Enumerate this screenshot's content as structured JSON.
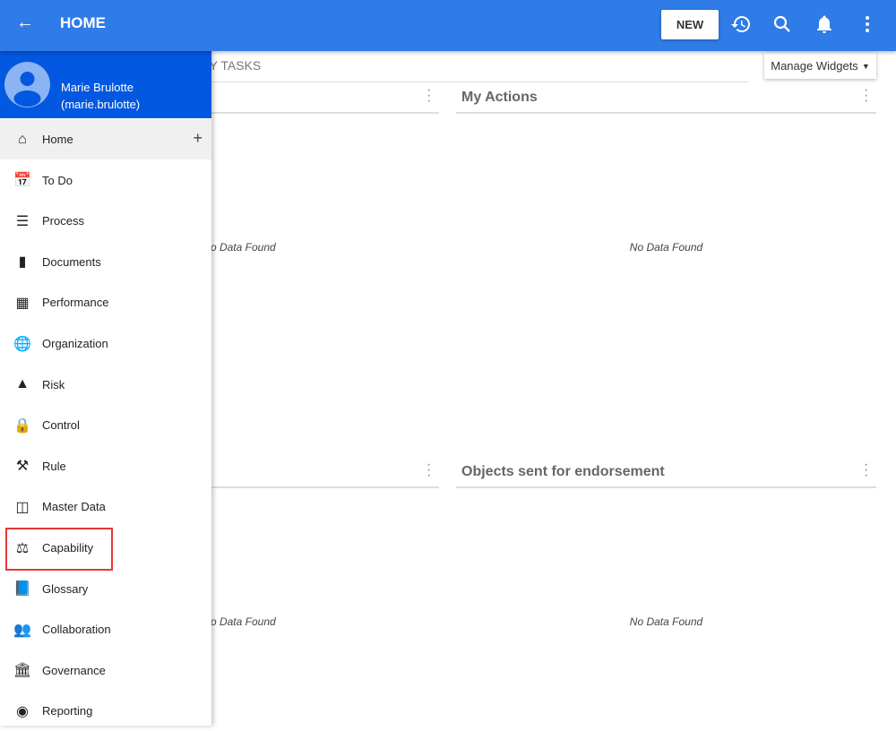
{
  "header": {
    "back_icon": "arrow-left-icon",
    "title": "HOME",
    "new_label": "NEW",
    "icons": [
      "history-icon",
      "search-icon",
      "bell-icon",
      "more-vert-icon"
    ]
  },
  "tabs": {
    "my_tasks": "MY TASKS"
  },
  "manage_widgets": "Manage Widgets",
  "widgets": [
    {
      "title": "",
      "empty": "No Data Found"
    },
    {
      "title": "My Actions",
      "empty": "No Data Found"
    },
    {
      "title": "",
      "empty": "No Data Found"
    },
    {
      "title": "Objects sent for endorsement",
      "empty": "No Data Found"
    }
  ],
  "user": {
    "name": "Marie Brulotte",
    "username": "(marie.brulotte)"
  },
  "sidebar": {
    "items": [
      {
        "label": "Home",
        "icon": "home-icon"
      },
      {
        "label": "To Do",
        "icon": "calendar-check-icon"
      },
      {
        "label": "Process",
        "icon": "process-icon"
      },
      {
        "label": "Documents",
        "icon": "document-icon"
      },
      {
        "label": "Performance",
        "icon": "chart-icon"
      },
      {
        "label": "Organization",
        "icon": "globe-icon"
      },
      {
        "label": "Risk",
        "icon": "warning-icon"
      },
      {
        "label": "Control",
        "icon": "lock-icon"
      },
      {
        "label": "Rule",
        "icon": "gavel-icon"
      },
      {
        "label": "Master Data",
        "icon": "cubes-icon"
      },
      {
        "label": "Capability",
        "icon": "scale-icon"
      },
      {
        "label": "Glossary",
        "icon": "book-icon"
      },
      {
        "label": "Collaboration",
        "icon": "people-icon"
      },
      {
        "label": "Governance",
        "icon": "bank-icon"
      },
      {
        "label": "Reporting",
        "icon": "target-icon"
      }
    ]
  },
  "colors": {
    "header": "#2f7be8",
    "user_panel": "#0258e0",
    "highlight": "#e53935"
  }
}
